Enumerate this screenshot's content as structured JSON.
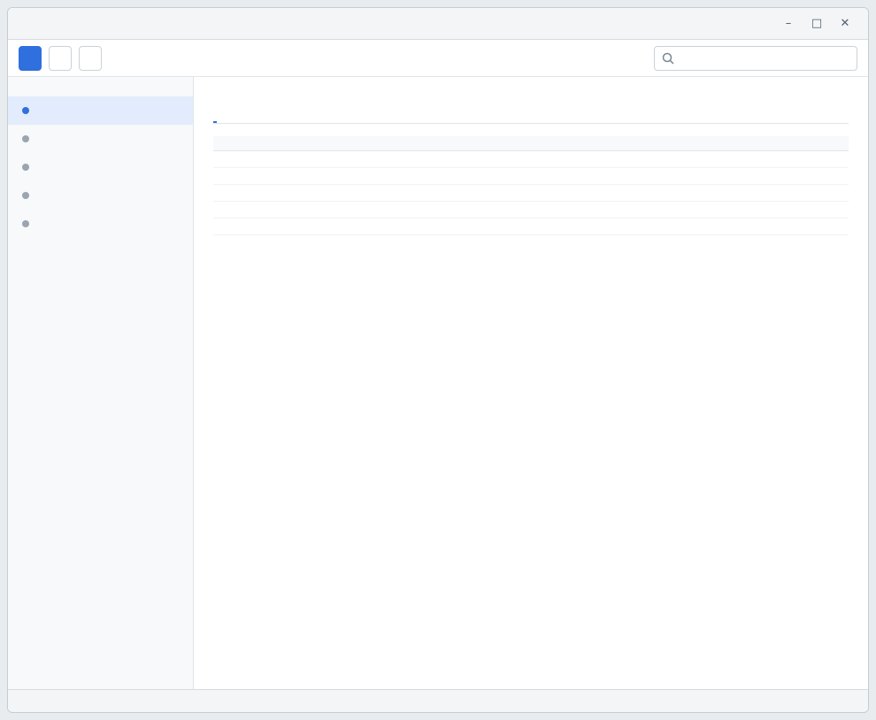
{
  "window": {
    "title": ""
  },
  "toolbar": {
    "buttons": [
      {
        "label": ""
      },
      {
        "label": ""
      },
      {
        "label": ""
      }
    ],
    "search": {
      "value": "",
      "placeholder": ""
    }
  },
  "sidebar": {
    "heading": "",
    "items": [
      {
        "label": ""
      },
      {
        "label": ""
      },
      {
        "label": ""
      },
      {
        "label": ""
      },
      {
        "label": ""
      }
    ]
  },
  "main": {
    "title": "",
    "subtitle": "",
    "tabs": [
      {
        "label": ""
      },
      {
        "label": ""
      },
      {
        "label": ""
      }
    ],
    "table": {
      "columns": [
        "",
        "",
        "",
        ""
      ],
      "rows": [
        [
          "",
          "",
          "",
          ""
        ],
        [
          "",
          "",
          "",
          ""
        ],
        [
          "",
          "",
          "",
          ""
        ],
        [
          "",
          "",
          "",
          ""
        ],
        [
          "",
          "",
          "",
          ""
        ]
      ]
    }
  },
  "statusbar": {
    "text": ""
  },
  "colors": {
    "accent": "#2f6fde"
  }
}
